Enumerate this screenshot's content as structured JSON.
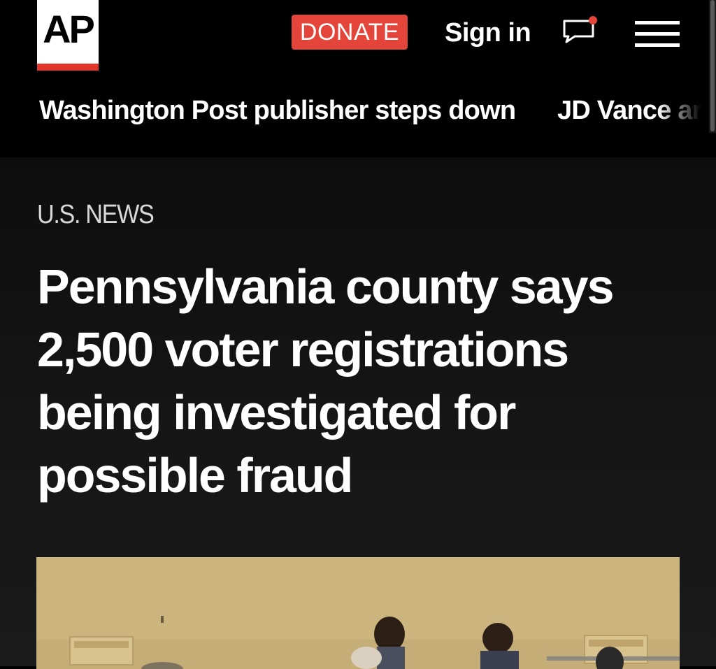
{
  "header": {
    "logo_text": "AP",
    "donate_label": "DONATE",
    "signin_label": "Sign in",
    "chat_icon": "chat-bubble-icon",
    "menu_icon": "hamburger-menu-icon"
  },
  "trending": {
    "items": [
      {
        "label": "Washington Post publisher steps down"
      },
      {
        "label": "JD Vance ar"
      }
    ]
  },
  "article": {
    "section": "U.S. NEWS",
    "headline": "Pennsylvania county says 2,500 voter registrations being investigated for possible fraud"
  },
  "colors": {
    "accent": "#e4453a",
    "logo_bar": "#e4352b",
    "background": "#000000",
    "notification_dot": "#e4453a"
  }
}
